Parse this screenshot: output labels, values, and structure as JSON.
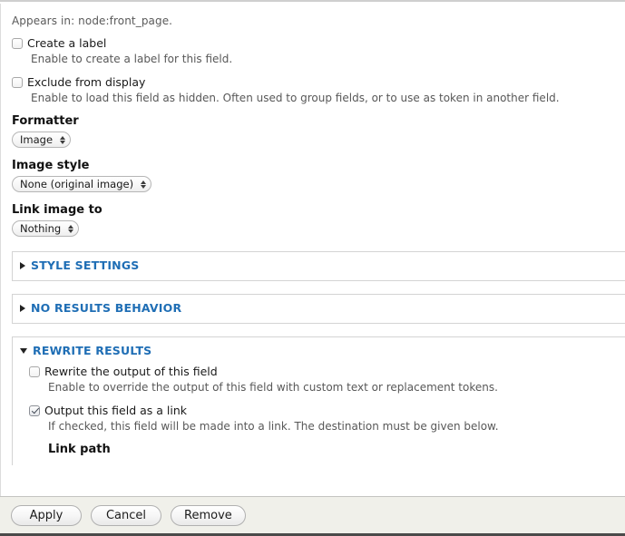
{
  "modal": {
    "appears_in": "Appears in: node:front_page."
  },
  "top_options": [
    {
      "id": "create-a-label",
      "label": "Create a label",
      "checked": false,
      "description": "Enable to create a label for this field."
    },
    {
      "id": "exclude-from-display",
      "label": "Exclude from display",
      "checked": false,
      "description": "Enable to load this field as hidden. Often used to group fields, or to use as token in another field."
    }
  ],
  "selects": [
    {
      "id": "formatter",
      "label": "Formatter",
      "value": "Image"
    },
    {
      "id": "image-style",
      "label": "Image style",
      "value": "None (original image)"
    },
    {
      "id": "link-image-to",
      "label": "Link image to",
      "value": "Nothing"
    }
  ],
  "fieldsets": [
    {
      "id": "style-settings",
      "title": "STYLE SETTINGS",
      "expanded": false
    },
    {
      "id": "no-results-behavior",
      "title": "NO RESULTS BEHAVIOR",
      "expanded": false
    },
    {
      "id": "rewrite-results",
      "title": "REWRITE RESULTS",
      "expanded": true
    }
  ],
  "rewrite_results": {
    "options": [
      {
        "id": "rewrite-the-output-of-this-field",
        "label": "Rewrite the output of this field",
        "checked": false,
        "description": "Enable to override the output of this field with custom text or replacement tokens."
      },
      {
        "id": "output-this-field-as-a-link",
        "label": "Output this field as a link",
        "checked": true,
        "description": "If checked, this field will be made into a link. The destination must be given below."
      }
    ],
    "clipped_label": "Link path"
  },
  "footer": {
    "buttons": [
      {
        "id": "apply",
        "label": "Apply"
      },
      {
        "id": "cancel",
        "label": "Cancel"
      },
      {
        "id": "remove",
        "label": "Remove"
      }
    ]
  },
  "colors": {
    "fieldset_title": "#1f6eb5",
    "description_text": "#585858",
    "footer_bg": "#f0f0ea",
    "page_bg": "#ffffff"
  }
}
